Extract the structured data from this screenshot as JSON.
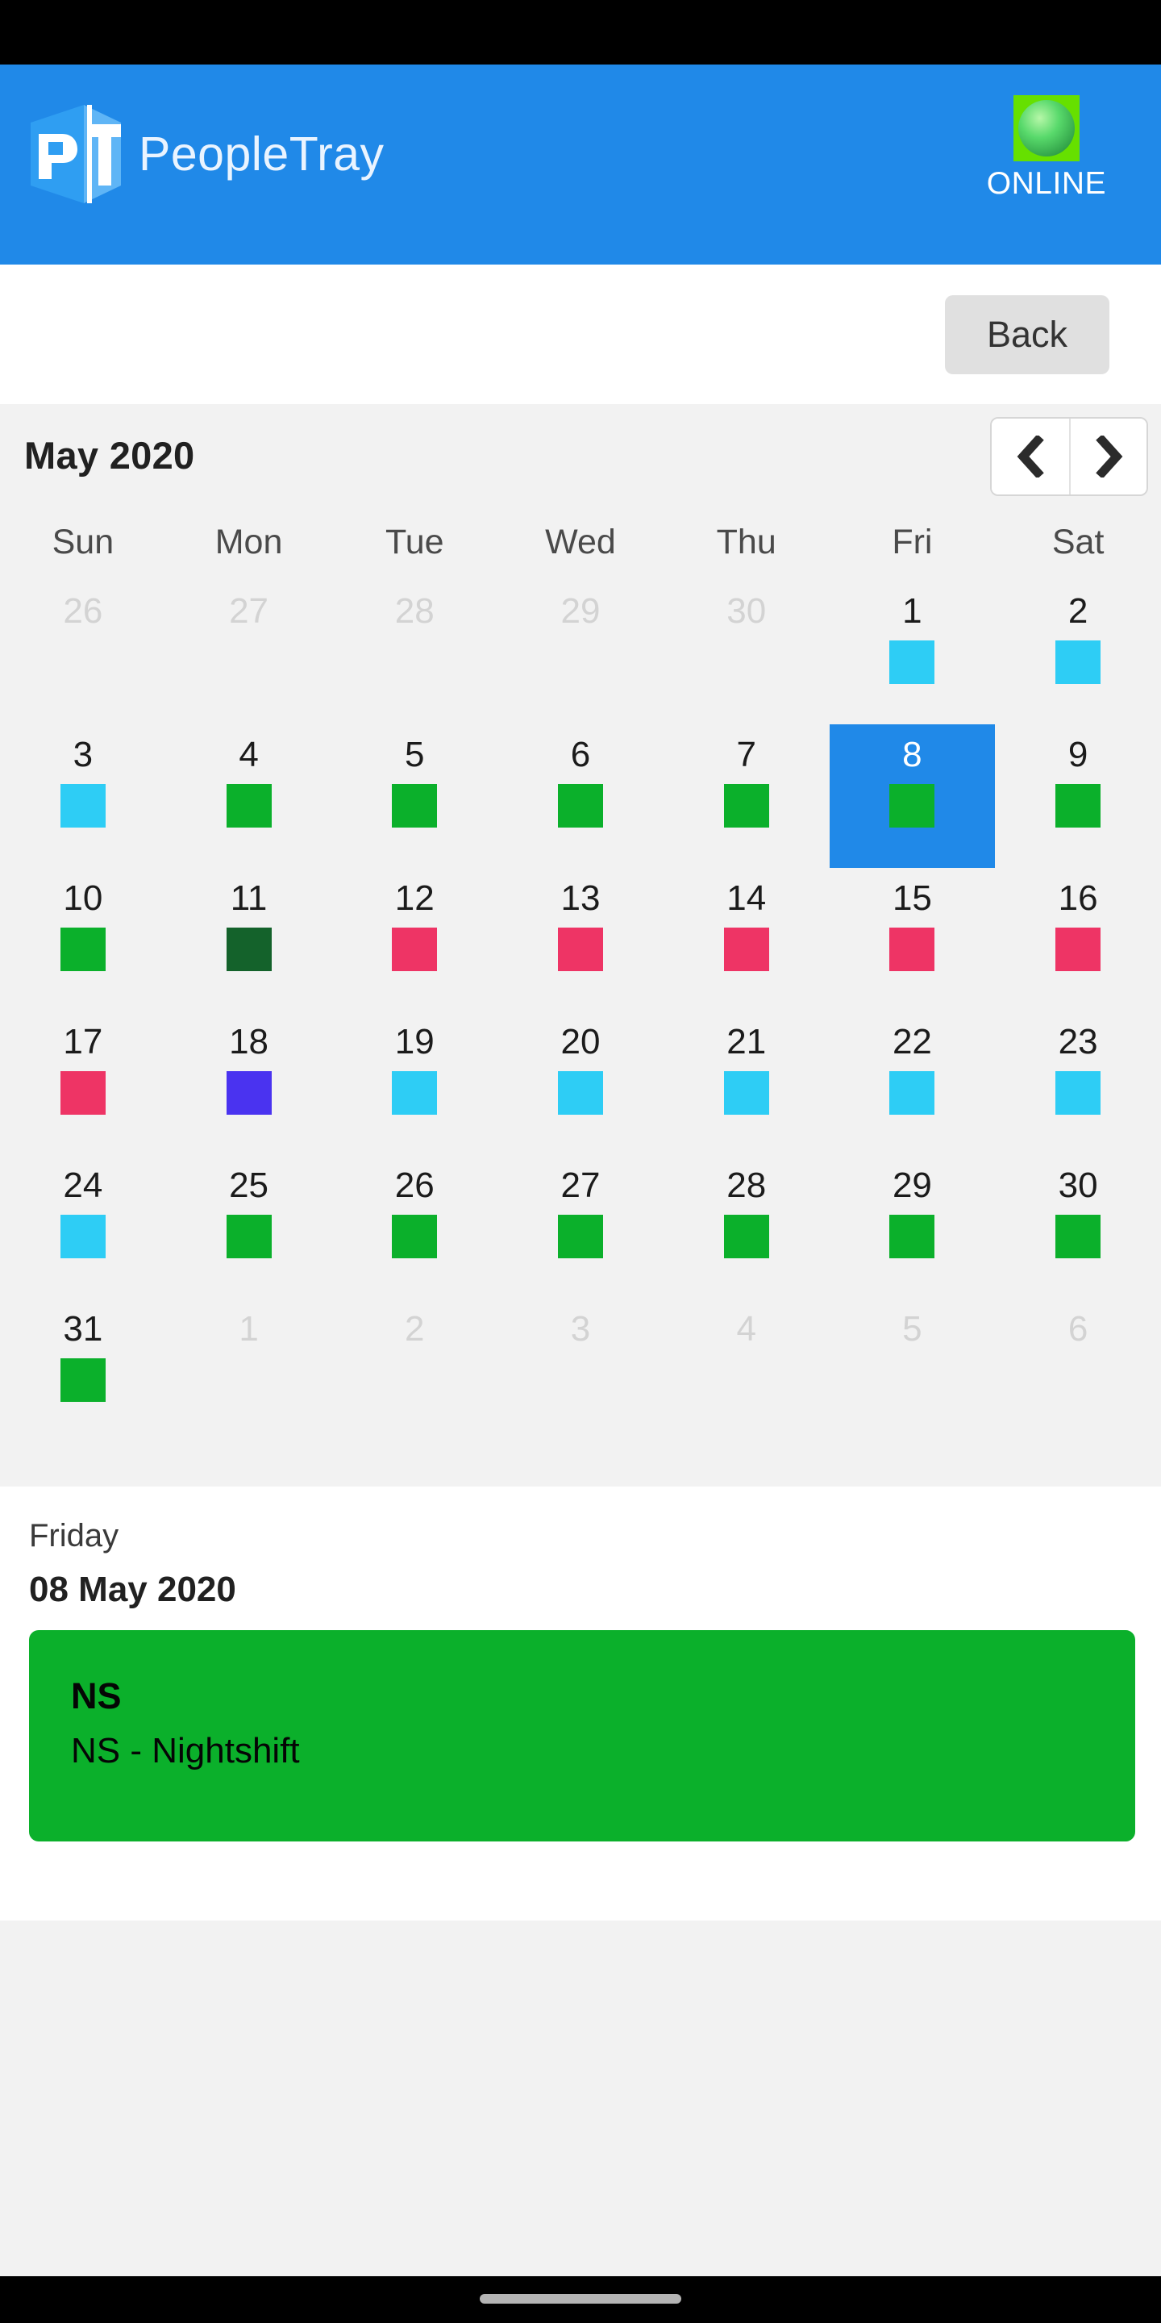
{
  "status_bar": {
    "background": "#000000"
  },
  "header": {
    "app_title": "PeopleTray",
    "logo_letters": [
      "P",
      "T"
    ],
    "brand_color": "#2089e8",
    "status": {
      "label": "ONLINE",
      "led_color": "#66e000",
      "indicator_icon": "green-sphere-icon"
    }
  },
  "toolbar": {
    "back_label": "Back"
  },
  "calendar": {
    "title": "May 2020",
    "month": "May",
    "year": "2020",
    "prev_icon": "chevron-left-icon",
    "next_icon": "chevron-right-icon",
    "day_headers": [
      "Sun",
      "Mon",
      "Tue",
      "Wed",
      "Thu",
      "Fri",
      "Sat"
    ],
    "selected_day": 8,
    "selection_color": "#2089e8",
    "background": "#f2f2f2",
    "marker_colors": {
      "green": "#0bb02b",
      "dark_green": "#14622b",
      "cyan": "#2ecdf5",
      "pink": "#ee3465",
      "purple": "#4a33f0",
      "none": "transparent"
    },
    "weeks": [
      [
        {
          "num": "26",
          "outside": true,
          "marker": "none"
        },
        {
          "num": "27",
          "outside": true,
          "marker": "none"
        },
        {
          "num": "28",
          "outside": true,
          "marker": "none"
        },
        {
          "num": "29",
          "outside": true,
          "marker": "none"
        },
        {
          "num": "30",
          "outside": true,
          "marker": "none"
        },
        {
          "num": "1",
          "outside": false,
          "marker": "cyan"
        },
        {
          "num": "2",
          "outside": false,
          "marker": "cyan"
        }
      ],
      [
        {
          "num": "3",
          "outside": false,
          "marker": "cyan"
        },
        {
          "num": "4",
          "outside": false,
          "marker": "green"
        },
        {
          "num": "5",
          "outside": false,
          "marker": "green"
        },
        {
          "num": "6",
          "outside": false,
          "marker": "green"
        },
        {
          "num": "7",
          "outside": false,
          "marker": "green"
        },
        {
          "num": "8",
          "outside": false,
          "marker": "green",
          "selected": true
        },
        {
          "num": "9",
          "outside": false,
          "marker": "green"
        }
      ],
      [
        {
          "num": "10",
          "outside": false,
          "marker": "green"
        },
        {
          "num": "11",
          "outside": false,
          "marker": "dark_green"
        },
        {
          "num": "12",
          "outside": false,
          "marker": "pink"
        },
        {
          "num": "13",
          "outside": false,
          "marker": "pink"
        },
        {
          "num": "14",
          "outside": false,
          "marker": "pink"
        },
        {
          "num": "15",
          "outside": false,
          "marker": "pink"
        },
        {
          "num": "16",
          "outside": false,
          "marker": "pink"
        }
      ],
      [
        {
          "num": "17",
          "outside": false,
          "marker": "pink"
        },
        {
          "num": "18",
          "outside": false,
          "marker": "purple"
        },
        {
          "num": "19",
          "outside": false,
          "marker": "cyan"
        },
        {
          "num": "20",
          "outside": false,
          "marker": "cyan"
        },
        {
          "num": "21",
          "outside": false,
          "marker": "cyan"
        },
        {
          "num": "22",
          "outside": false,
          "marker": "cyan"
        },
        {
          "num": "23",
          "outside": false,
          "marker": "cyan"
        }
      ],
      [
        {
          "num": "24",
          "outside": false,
          "marker": "cyan"
        },
        {
          "num": "25",
          "outside": false,
          "marker": "green"
        },
        {
          "num": "26",
          "outside": false,
          "marker": "green"
        },
        {
          "num": "27",
          "outside": false,
          "marker": "green"
        },
        {
          "num": "28",
          "outside": false,
          "marker": "green"
        },
        {
          "num": "29",
          "outside": false,
          "marker": "green"
        },
        {
          "num": "30",
          "outside": false,
          "marker": "green"
        }
      ],
      [
        {
          "num": "31",
          "outside": false,
          "marker": "green"
        },
        {
          "num": "1",
          "outside": true,
          "marker": "none"
        },
        {
          "num": "2",
          "outside": true,
          "marker": "none"
        },
        {
          "num": "3",
          "outside": true,
          "marker": "none"
        },
        {
          "num": "4",
          "outside": true,
          "marker": "none"
        },
        {
          "num": "5",
          "outside": true,
          "marker": "none"
        },
        {
          "num": "6",
          "outside": true,
          "marker": "none"
        }
      ]
    ]
  },
  "detail": {
    "weekday": "Friday",
    "date": "08 May 2020",
    "shift": {
      "code": "NS",
      "description": "NS - Nightshift",
      "color": "#0bb02b"
    }
  },
  "nav_bar": {
    "home_indicator": "home-indicator-pill"
  }
}
